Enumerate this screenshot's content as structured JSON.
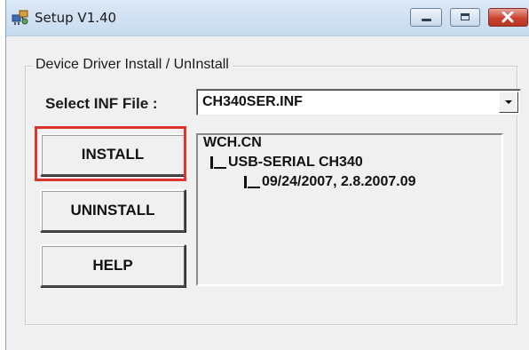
{
  "window": {
    "title": "Setup V1.40"
  },
  "titlebar_buttons": {
    "minimize_icon": "minimize-icon",
    "maximize_icon": "maximize-icon",
    "close_icon": "close-icon"
  },
  "group": {
    "label": "Device Driver Install / UnInstall"
  },
  "inf_select": {
    "label": "Select INF File :",
    "value": "CH340SER.INF"
  },
  "buttons": {
    "install": "INSTALL",
    "uninstall": "UNINSTALL",
    "help": "HELP"
  },
  "driver_info": {
    "vendor": "WCH.CN",
    "device": "USB-SERIAL CH340",
    "version": "09/24/2007, 2.8.2007.09"
  },
  "highlight_color": "#e0322f"
}
